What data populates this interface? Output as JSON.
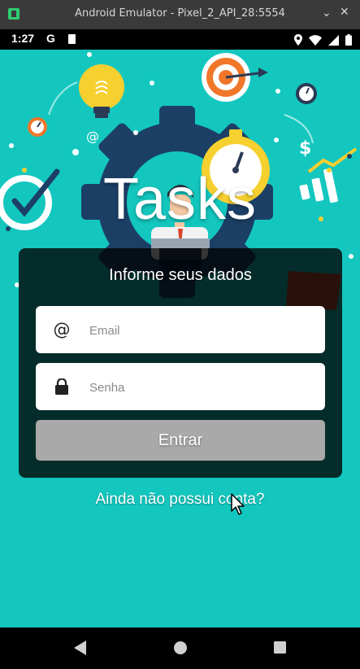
{
  "window": {
    "title": "Android Emulator - Pixel_2_API_28:5554",
    "controls": [
      "minimize",
      "maximize",
      "close"
    ]
  },
  "status_bar": {
    "time": "1:27",
    "google_label": "G"
  },
  "app": {
    "title": "Tasks",
    "subtitle": "Informe seus dados",
    "email": {
      "placeholder": "Email",
      "value": "",
      "icon": "at-icon"
    },
    "password": {
      "placeholder": "Senha",
      "value": "",
      "icon": "lock-icon"
    },
    "login_button": "Entrar",
    "signup_link": "Ainda não possui conta?"
  },
  "colors": {
    "background": "#13c7bf",
    "card": "#000000c7",
    "button": "#a9a9a9"
  },
  "nav_bar": {
    "icons": [
      "back-icon",
      "home-icon",
      "recents-icon"
    ]
  }
}
